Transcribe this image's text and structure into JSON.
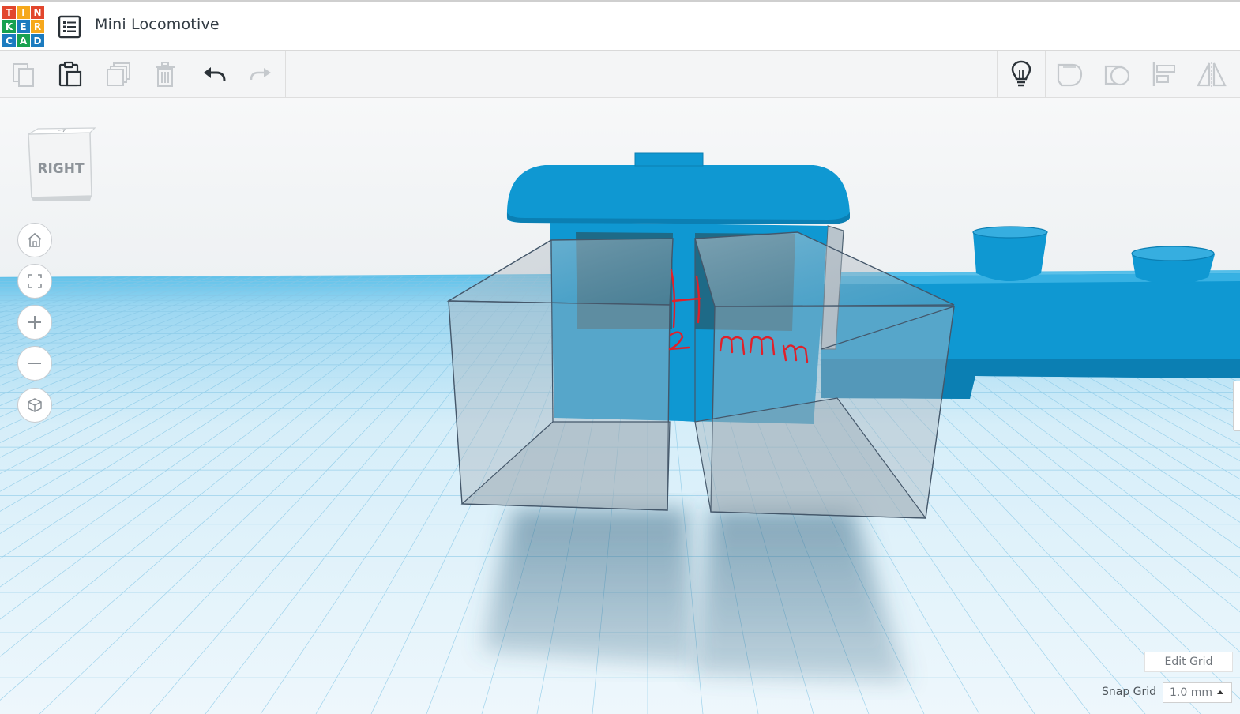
{
  "app": {
    "logo_letters": [
      "T",
      "I",
      "N",
      "K",
      "E",
      "R",
      "C",
      "A",
      "D"
    ],
    "logo_colors": [
      "#e2462d",
      "#f6a81c",
      "#e2462d",
      "#18a150",
      "#1c7bbf",
      "#f6a81c",
      "#1c7bbf",
      "#18a150",
      "#1c7bbf"
    ]
  },
  "header": {
    "title": "Mini Locomotive",
    "menu_icon": "list-icon"
  },
  "toolbar": {
    "left_tools": [
      {
        "name": "copy",
        "icon": "copy-icon",
        "enabled": false
      },
      {
        "name": "paste",
        "icon": "paste-icon",
        "enabled": true
      },
      {
        "name": "duplicate",
        "icon": "duplicate-icon",
        "enabled": false
      },
      {
        "name": "delete",
        "icon": "trash-icon",
        "enabled": false
      },
      {
        "name": "undo",
        "icon": "undo-icon",
        "enabled": true
      },
      {
        "name": "redo",
        "icon": "redo-icon",
        "enabled": false
      }
    ],
    "right_tools": [
      {
        "name": "show-hint",
        "icon": "lightbulb-icon",
        "enabled": true
      },
      {
        "name": "group",
        "icon": "group-icon",
        "enabled": false
      },
      {
        "name": "ungroup",
        "icon": "ungroup-icon",
        "enabled": false
      },
      {
        "name": "align",
        "icon": "align-icon",
        "enabled": false
      },
      {
        "name": "mirror",
        "icon": "mirror-icon",
        "enabled": false
      }
    ]
  },
  "viewport": {
    "view_cube_face": "RIGHT",
    "nav_buttons": [
      "home-icon",
      "fit-view-icon",
      "zoom-in-icon",
      "zoom-out-icon",
      "perspective-icon"
    ],
    "annotation_text": "1 2 mm",
    "shape_color": "#0f98d2",
    "grid_color": "#bfe2f3"
  },
  "grid_controls": {
    "edit_grid_label": "Edit Grid",
    "snap_grid_label": "Snap Grid",
    "snap_grid_value": "1.0 mm"
  }
}
